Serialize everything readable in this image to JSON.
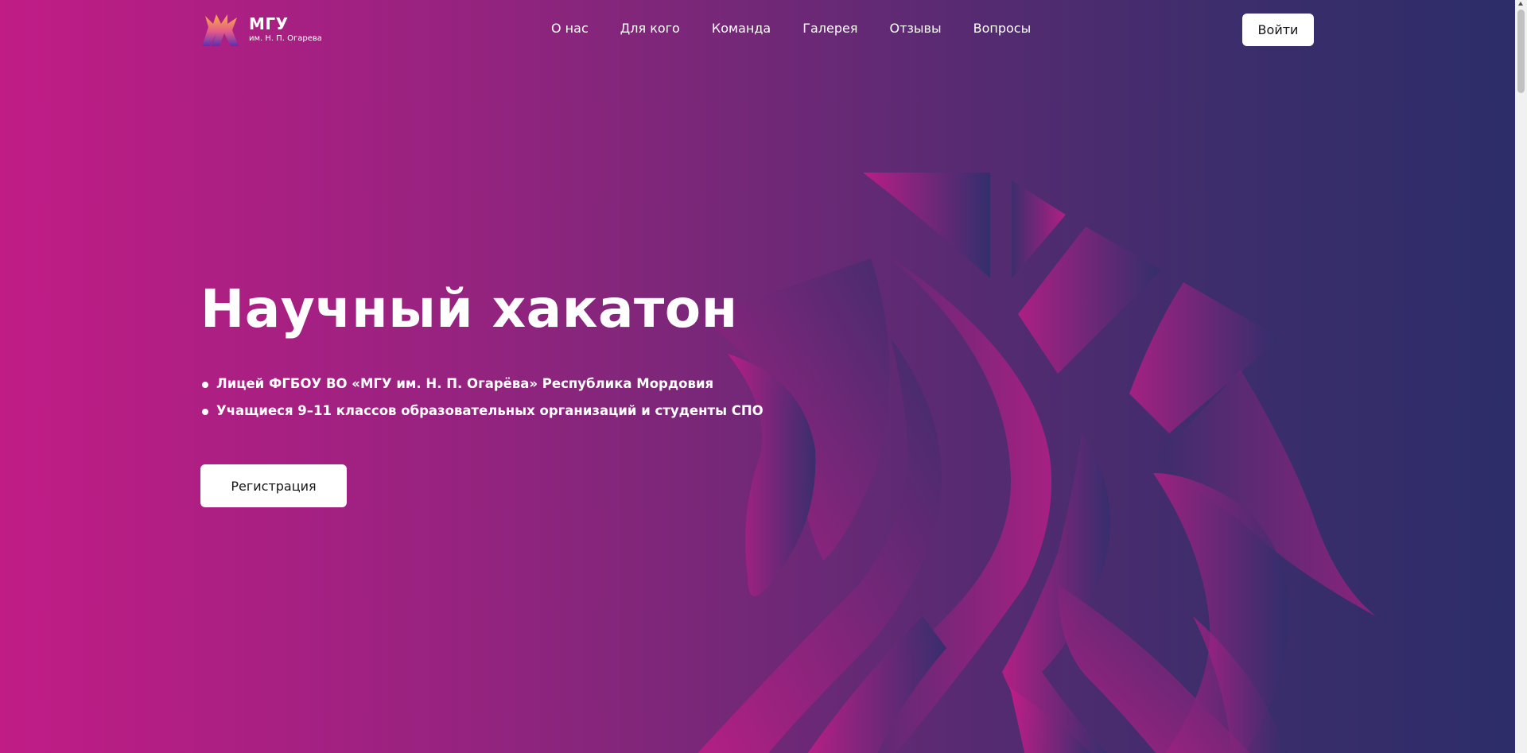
{
  "colors": {
    "gradient_start": "#c11c86",
    "gradient_end": "#2c2d69",
    "button_bg": "#ffffff",
    "button_text": "#151515"
  },
  "header": {
    "logo": {
      "title": "МГУ",
      "subtitle": "им. Н. П. Огарева",
      "icon": "flame-logo-icon"
    },
    "nav": [
      {
        "label": "О нас"
      },
      {
        "label": "Для кого"
      },
      {
        "label": "Команда"
      },
      {
        "label": "Галерея"
      },
      {
        "label": "Отзывы"
      },
      {
        "label": "Вопросы"
      }
    ],
    "login_label": "Войти"
  },
  "hero": {
    "title": "Научный хакатон",
    "bullets": [
      "Лицей ФГБОУ ВО «МГУ им. Н. П. Огарёва» Республика Мордовия",
      "Учащиеся 9–11 классов образовательных организаций и студенты СПО"
    ],
    "register_label": "Регистрация"
  }
}
